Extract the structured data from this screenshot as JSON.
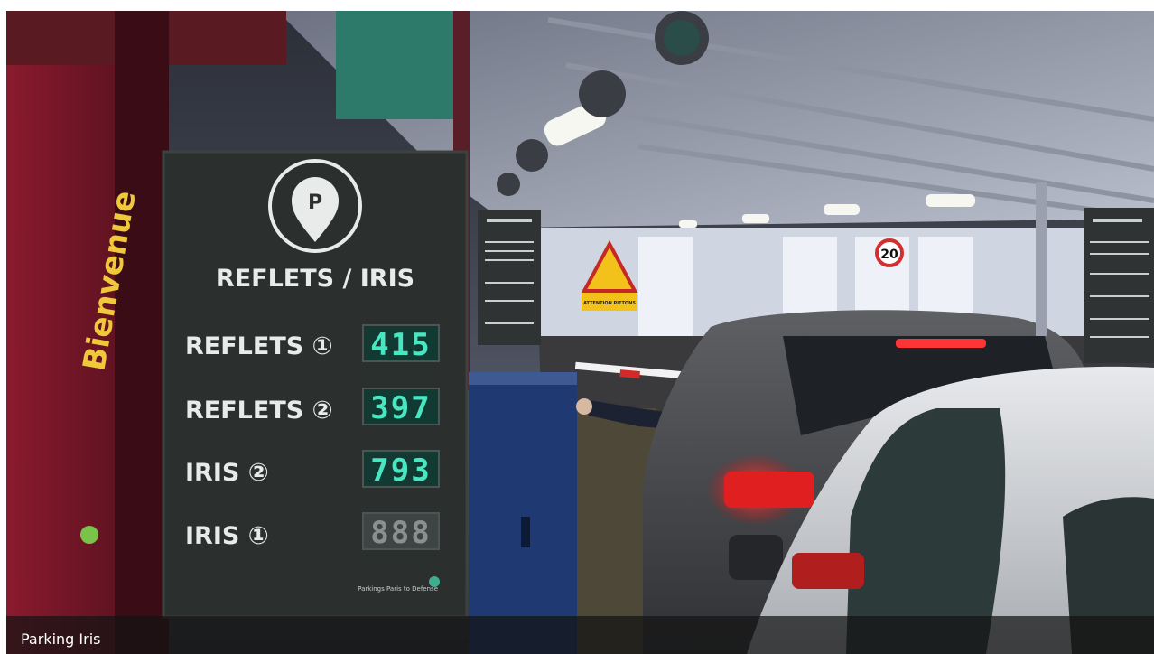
{
  "caption": "Parking Iris",
  "sign": {
    "title": "REFLETS / IRIS",
    "rows": [
      {
        "label": "REFLETS ①",
        "count": "415",
        "lit": true
      },
      {
        "label": "REFLETS ②",
        "count": "397",
        "lit": true
      },
      {
        "label": "IRIS ②",
        "count": "793",
        "lit": true
      },
      {
        "label": "IRIS ①",
        "count": "888",
        "lit": false
      }
    ],
    "logo_text": "Parkings Paris to Defense"
  },
  "wall_text": "Bienvenue",
  "warning_sign_text": "ATTENTION PIETONS",
  "speed_limit": "20",
  "colors": {
    "sign_panel": "#2b302f",
    "counter_lit": "#49e6c2",
    "wall_red": "#7a1628",
    "car_light": "#ff2a2a"
  }
}
